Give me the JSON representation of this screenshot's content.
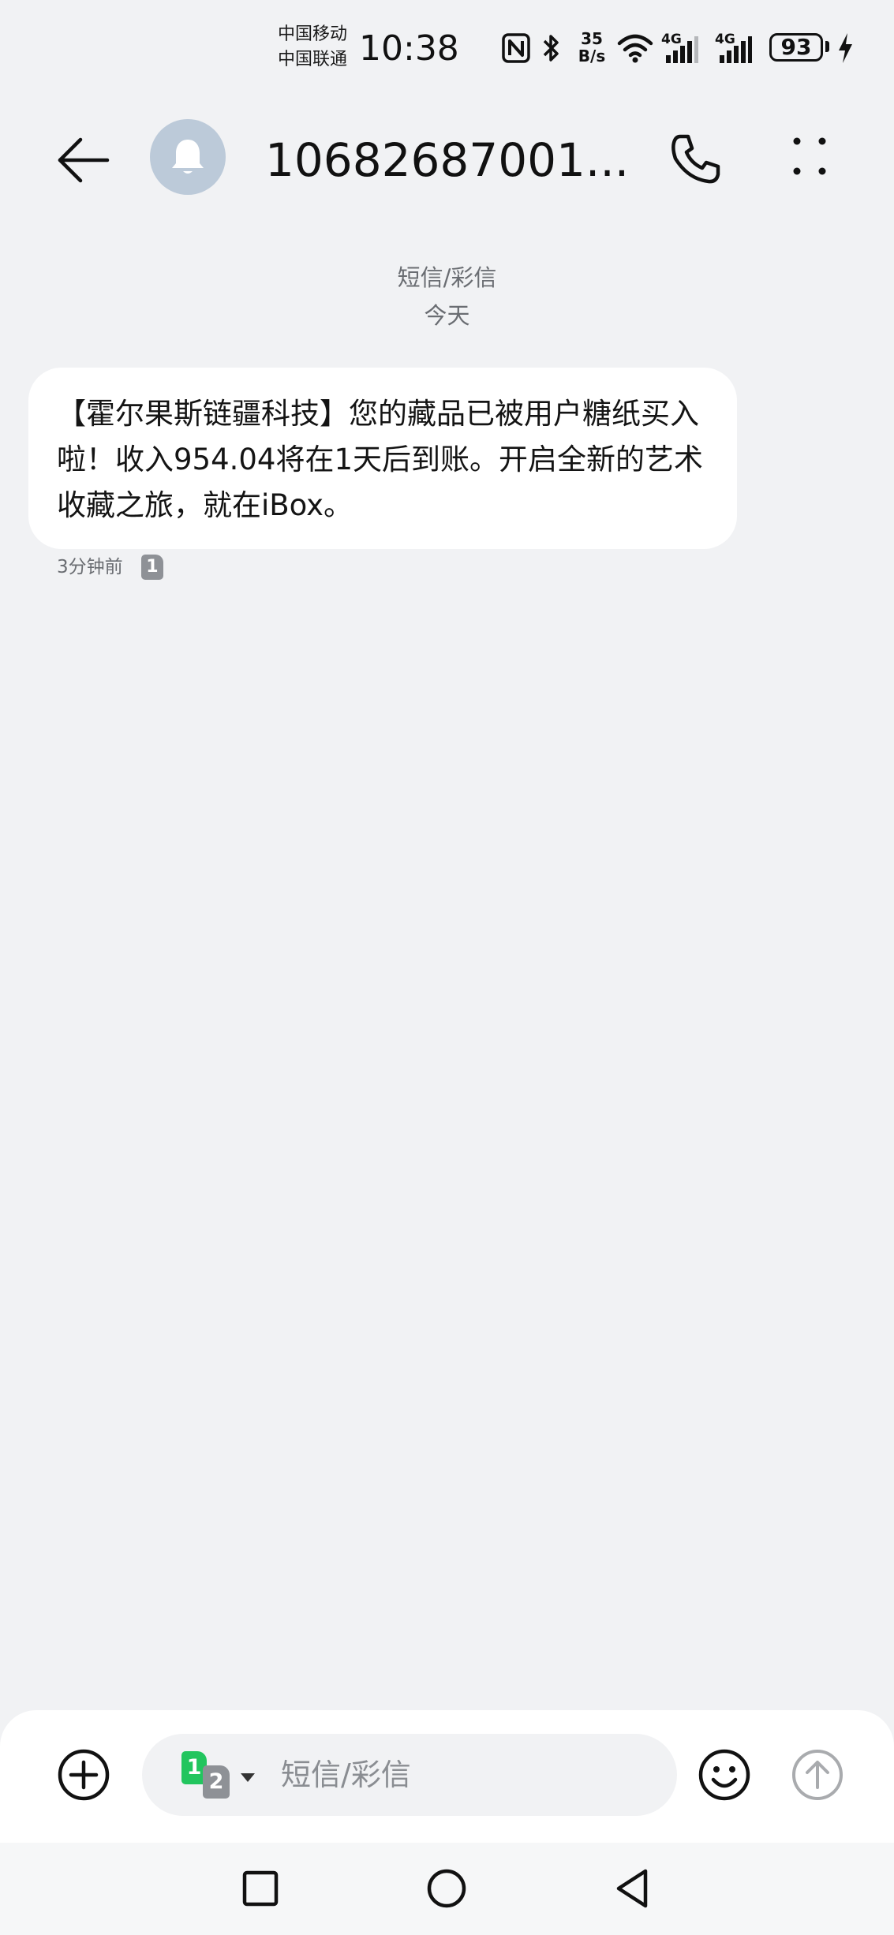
{
  "status_bar": {
    "carrier_1": "中国移动",
    "carrier_2": "中国联通",
    "time": "10:38",
    "net_speed_value": "35",
    "net_speed_unit": "B/s",
    "sim1_network": "4G",
    "sim2_network": "4G",
    "battery_percent": "93",
    "icons": [
      "nfc-icon",
      "bluetooth-icon",
      "wifi-icon",
      "signal-icon",
      "signal-icon",
      "battery-icon",
      "charging-icon"
    ]
  },
  "header": {
    "contact_name": "10682687001...",
    "icons": [
      "back-arrow-icon",
      "bell-icon",
      "phone-icon",
      "more-dots-icon"
    ]
  },
  "thread": {
    "type_label": "短信/彩信",
    "date_label": "今天"
  },
  "messages": [
    {
      "text": "【霍尔果斯链疆科技】您的藏品已被用户糖纸买入啦！收入954.04将在1天后到账。开启全新的艺术收藏之旅，就在iBox。",
      "time": "3分钟前",
      "sim": "1"
    }
  ],
  "composer": {
    "sim_primary": "1",
    "sim_secondary": "2",
    "placeholder": "短信/彩信",
    "value": "",
    "icons": [
      "add-circle-icon",
      "emoji-icon",
      "send-arrow-icon"
    ]
  },
  "nav": {
    "icons": [
      "recents-square-icon",
      "home-circle-icon",
      "back-triangle-icon"
    ]
  },
  "colors": {
    "background": "#f1f2f4",
    "bubble": "#ffffff",
    "avatar": "#bccad9",
    "sim1": "#22c55e",
    "sim2": "#8e9196"
  }
}
